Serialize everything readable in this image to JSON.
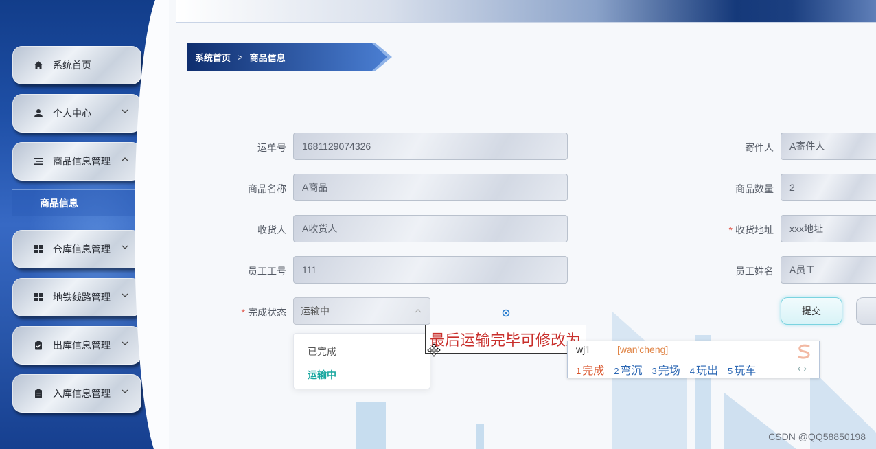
{
  "sidebar": {
    "items": [
      {
        "label": "系统首页",
        "icon": "home-icon"
      },
      {
        "label": "个人中心",
        "icon": "user-icon"
      },
      {
        "label": "商品信息管理",
        "icon": "list-icon"
      },
      {
        "label": "仓库信息管理",
        "icon": "grid-icon"
      },
      {
        "label": "地铁线路管理",
        "icon": "grid-icon"
      },
      {
        "label": "出库信息管理",
        "icon": "clipboard-check-icon"
      },
      {
        "label": "入库信息管理",
        "icon": "clipboard-icon"
      }
    ],
    "submenu_label": "商品信息"
  },
  "breadcrumb": {
    "home": "系统首页",
    "separator": ">",
    "current": "商品信息"
  },
  "form": {
    "waybill_label": "运单号",
    "waybill_value": "1681129074326",
    "sender_label": "寄件人",
    "sender_value": "A寄件人",
    "product_name_label": "商品名称",
    "product_name_value": "A商品",
    "quantity_label": "商品数量",
    "quantity_value": "2",
    "receiver_label": "收货人",
    "receiver_value": "A收货人",
    "address_label": "收货地址",
    "address_value": "xxx地址",
    "employee_id_label": "员工工号",
    "employee_id_value": "111",
    "employee_name_label": "员工姓名",
    "employee_name_value": "A员工",
    "status_label": "完成状态",
    "status_value": "运输中",
    "required_mark": "*",
    "status_options": [
      "已完成",
      "运输中"
    ],
    "submit_label": "提交"
  },
  "ime": {
    "typed_text": "最后运输完毕可修改为",
    "pinyin_input": "wj'l",
    "pinyin_hint": "[wan'cheng]",
    "candidates": [
      {
        "n": "1",
        "text": "完成"
      },
      {
        "n": "2",
        "text": "弯沉"
      },
      {
        "n": "3",
        "text": "完场"
      },
      {
        "n": "4",
        "text": "玩出"
      },
      {
        "n": "5",
        "text": "玩车"
      }
    ],
    "nav": "‹ ›"
  },
  "watermark": "CSDN @QQ58850198",
  "colors": {
    "accent": "#1aa8a0",
    "required": "#e25b4f",
    "sidebar": "#2856aa"
  }
}
